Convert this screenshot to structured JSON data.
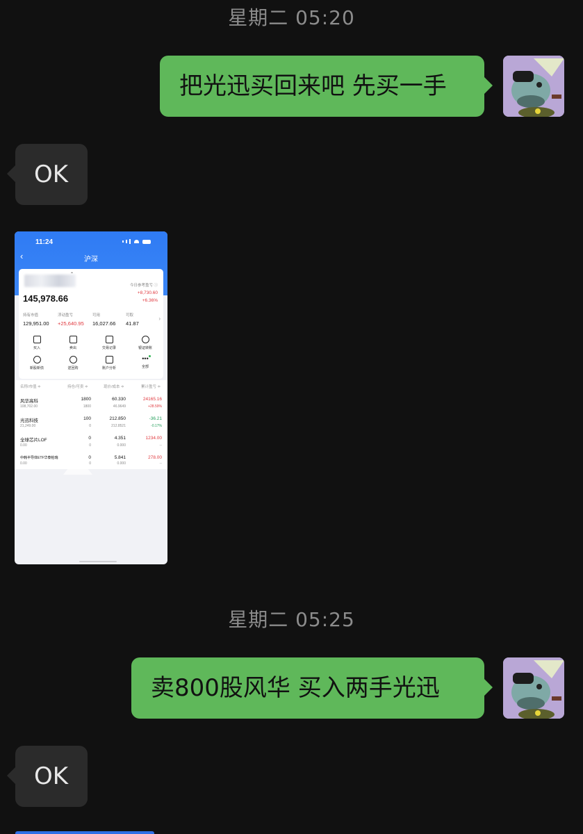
{
  "chat": {
    "timestamps": [
      "星期二 05:20",
      "星期二 05:25"
    ],
    "messages": {
      "m1": "把光迅买回来吧 先买一手",
      "m2": "OK",
      "m3": "卖800股风华 买入两手光迅",
      "m4": "OK"
    }
  },
  "screenshot": {
    "status_time": "11:24",
    "nav_title": "沪深",
    "total_assets": "145,978.66",
    "today_pl_label": "今日参考盈亏 ⓘ",
    "today_pl_value": "+8,730.60",
    "today_pl_pct": "+6.36%",
    "stats": [
      {
        "label": "持有市值",
        "value": "129,951.00"
      },
      {
        "label": "浮动盈亏",
        "value": "+25,640.95"
      },
      {
        "label": "可用",
        "value": "16,027.66"
      },
      {
        "label": "可取",
        "value": "41.87"
      }
    ],
    "actions_row1": [
      "买入",
      "卖出",
      "交易记录",
      "银证转账"
    ],
    "actions_row2": [
      "新股新债",
      "逆回购",
      "账户分析",
      "全部"
    ],
    "columns": [
      "名称/市值 ≑",
      "持仓/可卖 ≑",
      "现价/成本 ≑",
      "累计盈亏 ≑"
    ],
    "rows": [
      {
        "name": "风华高科",
        "mv": "108,702.00",
        "hold": "1800",
        "avail": "1800",
        "price": "60.330",
        "cost": "46.9649",
        "pl": "24165.16",
        "pct": "+28.59%"
      },
      {
        "name": "光迅科技",
        "mv": "21,249.00",
        "hold": "100",
        "avail": "0",
        "price": "212.850",
        "cost": "212.8521",
        "pl": "-36.21",
        "pct": "-0.17%"
      },
      {
        "name": "全球芯片LOF",
        "mv": "0.00",
        "hold": "0",
        "avail": "0",
        "price": "4.351",
        "cost": "0.000",
        "pl": "1234.00",
        "pct": "--"
      },
      {
        "name": "中韩半导体ETF华泰柏瑞",
        "mv": "0.00",
        "hold": "0",
        "avail": "0",
        "price": "5.841",
        "cost": "0.000",
        "pl": "278.00",
        "pct": "--"
      }
    ]
  },
  "colors": {
    "background": "#111111",
    "outgoing_bubble": "#5fb85a",
    "incoming_bubble": "#2b2b2b",
    "timestamp_text": "#8c8c8c",
    "app_blue": "#2f7bf4",
    "profit_red": "#e0383e",
    "loss_green": "#1f9c57"
  }
}
